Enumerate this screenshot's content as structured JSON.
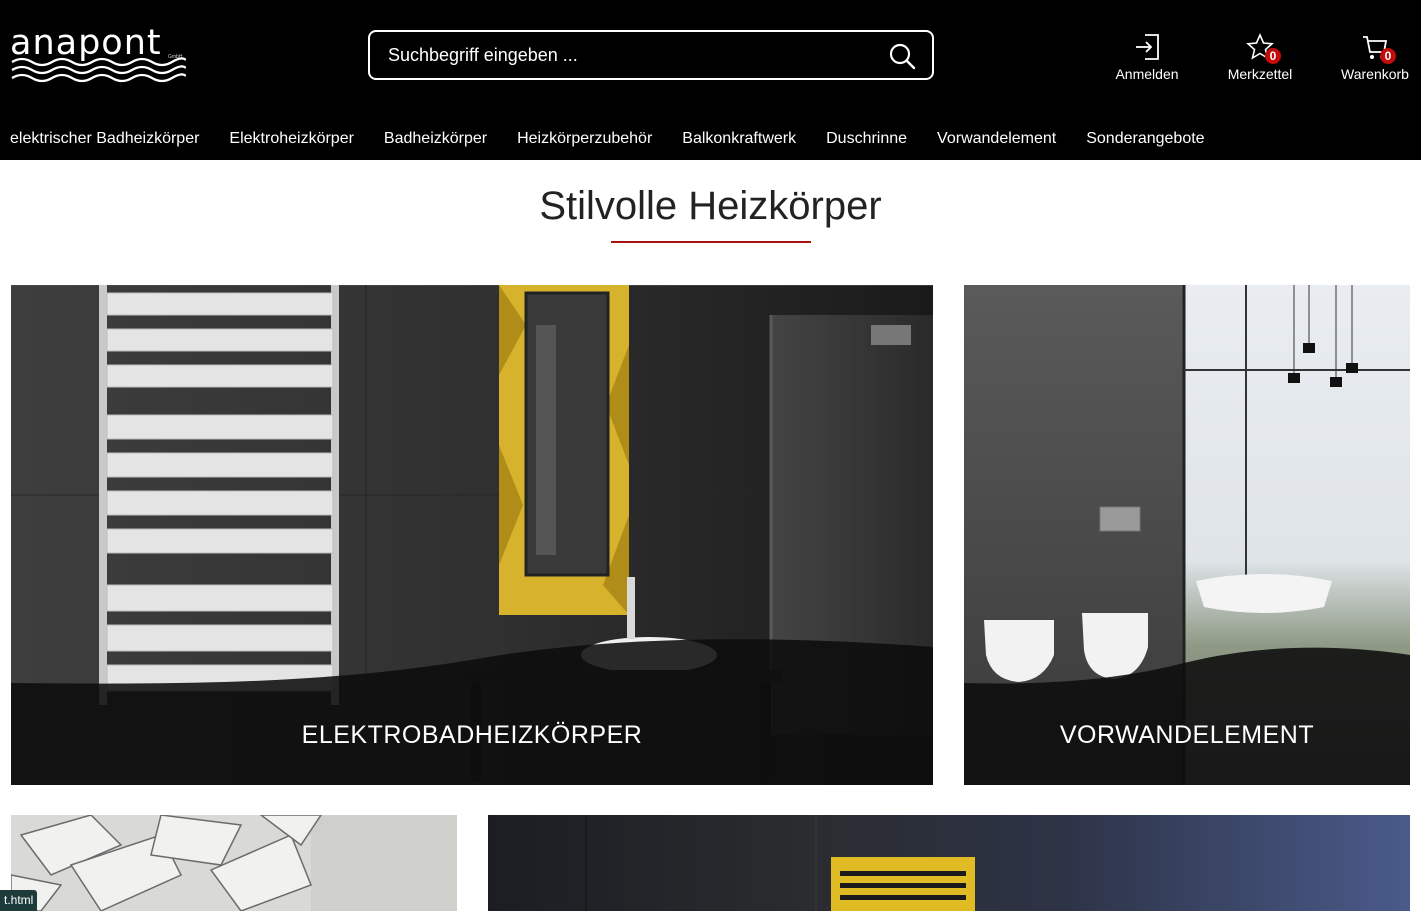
{
  "header": {
    "logo_text": "anapont",
    "logo_sub": "GmbH",
    "search_placeholder": "Suchbegriff eingeben ...",
    "actions": {
      "login": "Anmelden",
      "wishlist": "Merkzettel",
      "wishlist_count": "0",
      "cart": "Warenkorb",
      "cart_count": "0"
    }
  },
  "nav": {
    "items": [
      "elektrischer Badheizkörper",
      "Elektroheizkörper",
      "Badheizkörper",
      "Heizkörperzubehör",
      "Balkonkraftwerk",
      "Duschrinne",
      "Vorwandelement",
      "Sonderangebote"
    ]
  },
  "section": {
    "title": "Stilvolle Heizkörper"
  },
  "tiles": {
    "t1_label": "ELEKTROBADHEIZKÖRPER",
    "t2_label": "VORWANDELEMENT"
  },
  "statusbar": {
    "text": "t.html"
  },
  "colors": {
    "header_bg": "#000000",
    "accent_line": "#aa1111",
    "badge": "#c40b0b"
  }
}
